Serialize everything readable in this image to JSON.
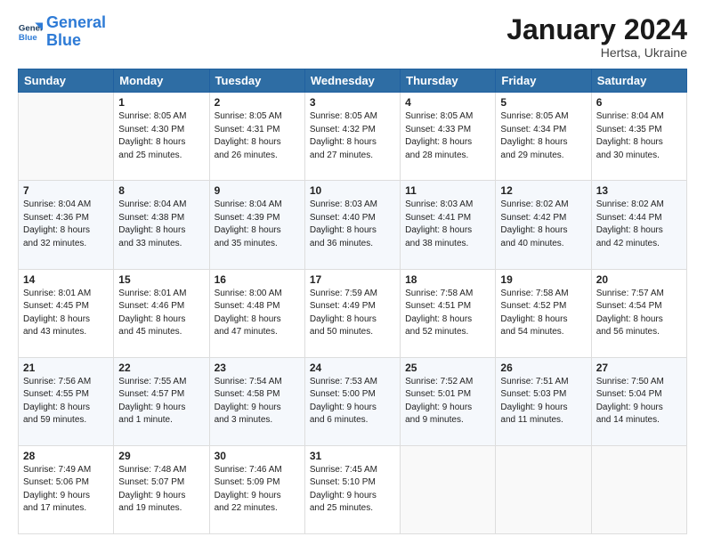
{
  "header": {
    "logo_line1": "General",
    "logo_line2": "Blue",
    "month_year": "January 2024",
    "location": "Hertsa, Ukraine"
  },
  "weekdays": [
    "Sunday",
    "Monday",
    "Tuesday",
    "Wednesday",
    "Thursday",
    "Friday",
    "Saturday"
  ],
  "weeks": [
    [
      {
        "day": "",
        "info": ""
      },
      {
        "day": "1",
        "info": "Sunrise: 8:05 AM\nSunset: 4:30 PM\nDaylight: 8 hours\nand 25 minutes."
      },
      {
        "day": "2",
        "info": "Sunrise: 8:05 AM\nSunset: 4:31 PM\nDaylight: 8 hours\nand 26 minutes."
      },
      {
        "day": "3",
        "info": "Sunrise: 8:05 AM\nSunset: 4:32 PM\nDaylight: 8 hours\nand 27 minutes."
      },
      {
        "day": "4",
        "info": "Sunrise: 8:05 AM\nSunset: 4:33 PM\nDaylight: 8 hours\nand 28 minutes."
      },
      {
        "day": "5",
        "info": "Sunrise: 8:05 AM\nSunset: 4:34 PM\nDaylight: 8 hours\nand 29 minutes."
      },
      {
        "day": "6",
        "info": "Sunrise: 8:04 AM\nSunset: 4:35 PM\nDaylight: 8 hours\nand 30 minutes."
      }
    ],
    [
      {
        "day": "7",
        "info": "Sunrise: 8:04 AM\nSunset: 4:36 PM\nDaylight: 8 hours\nand 32 minutes."
      },
      {
        "day": "8",
        "info": "Sunrise: 8:04 AM\nSunset: 4:38 PM\nDaylight: 8 hours\nand 33 minutes."
      },
      {
        "day": "9",
        "info": "Sunrise: 8:04 AM\nSunset: 4:39 PM\nDaylight: 8 hours\nand 35 minutes."
      },
      {
        "day": "10",
        "info": "Sunrise: 8:03 AM\nSunset: 4:40 PM\nDaylight: 8 hours\nand 36 minutes."
      },
      {
        "day": "11",
        "info": "Sunrise: 8:03 AM\nSunset: 4:41 PM\nDaylight: 8 hours\nand 38 minutes."
      },
      {
        "day": "12",
        "info": "Sunrise: 8:02 AM\nSunset: 4:42 PM\nDaylight: 8 hours\nand 40 minutes."
      },
      {
        "day": "13",
        "info": "Sunrise: 8:02 AM\nSunset: 4:44 PM\nDaylight: 8 hours\nand 42 minutes."
      }
    ],
    [
      {
        "day": "14",
        "info": "Sunrise: 8:01 AM\nSunset: 4:45 PM\nDaylight: 8 hours\nand 43 minutes."
      },
      {
        "day": "15",
        "info": "Sunrise: 8:01 AM\nSunset: 4:46 PM\nDaylight: 8 hours\nand 45 minutes."
      },
      {
        "day": "16",
        "info": "Sunrise: 8:00 AM\nSunset: 4:48 PM\nDaylight: 8 hours\nand 47 minutes."
      },
      {
        "day": "17",
        "info": "Sunrise: 7:59 AM\nSunset: 4:49 PM\nDaylight: 8 hours\nand 50 minutes."
      },
      {
        "day": "18",
        "info": "Sunrise: 7:58 AM\nSunset: 4:51 PM\nDaylight: 8 hours\nand 52 minutes."
      },
      {
        "day": "19",
        "info": "Sunrise: 7:58 AM\nSunset: 4:52 PM\nDaylight: 8 hours\nand 54 minutes."
      },
      {
        "day": "20",
        "info": "Sunrise: 7:57 AM\nSunset: 4:54 PM\nDaylight: 8 hours\nand 56 minutes."
      }
    ],
    [
      {
        "day": "21",
        "info": "Sunrise: 7:56 AM\nSunset: 4:55 PM\nDaylight: 8 hours\nand 59 minutes."
      },
      {
        "day": "22",
        "info": "Sunrise: 7:55 AM\nSunset: 4:57 PM\nDaylight: 9 hours\nand 1 minute."
      },
      {
        "day": "23",
        "info": "Sunrise: 7:54 AM\nSunset: 4:58 PM\nDaylight: 9 hours\nand 3 minutes."
      },
      {
        "day": "24",
        "info": "Sunrise: 7:53 AM\nSunset: 5:00 PM\nDaylight: 9 hours\nand 6 minutes."
      },
      {
        "day": "25",
        "info": "Sunrise: 7:52 AM\nSunset: 5:01 PM\nDaylight: 9 hours\nand 9 minutes."
      },
      {
        "day": "26",
        "info": "Sunrise: 7:51 AM\nSunset: 5:03 PM\nDaylight: 9 hours\nand 11 minutes."
      },
      {
        "day": "27",
        "info": "Sunrise: 7:50 AM\nSunset: 5:04 PM\nDaylight: 9 hours\nand 14 minutes."
      }
    ],
    [
      {
        "day": "28",
        "info": "Sunrise: 7:49 AM\nSunset: 5:06 PM\nDaylight: 9 hours\nand 17 minutes."
      },
      {
        "day": "29",
        "info": "Sunrise: 7:48 AM\nSunset: 5:07 PM\nDaylight: 9 hours\nand 19 minutes."
      },
      {
        "day": "30",
        "info": "Sunrise: 7:46 AM\nSunset: 5:09 PM\nDaylight: 9 hours\nand 22 minutes."
      },
      {
        "day": "31",
        "info": "Sunrise: 7:45 AM\nSunset: 5:10 PM\nDaylight: 9 hours\nand 25 minutes."
      },
      {
        "day": "",
        "info": ""
      },
      {
        "day": "",
        "info": ""
      },
      {
        "day": "",
        "info": ""
      }
    ]
  ]
}
